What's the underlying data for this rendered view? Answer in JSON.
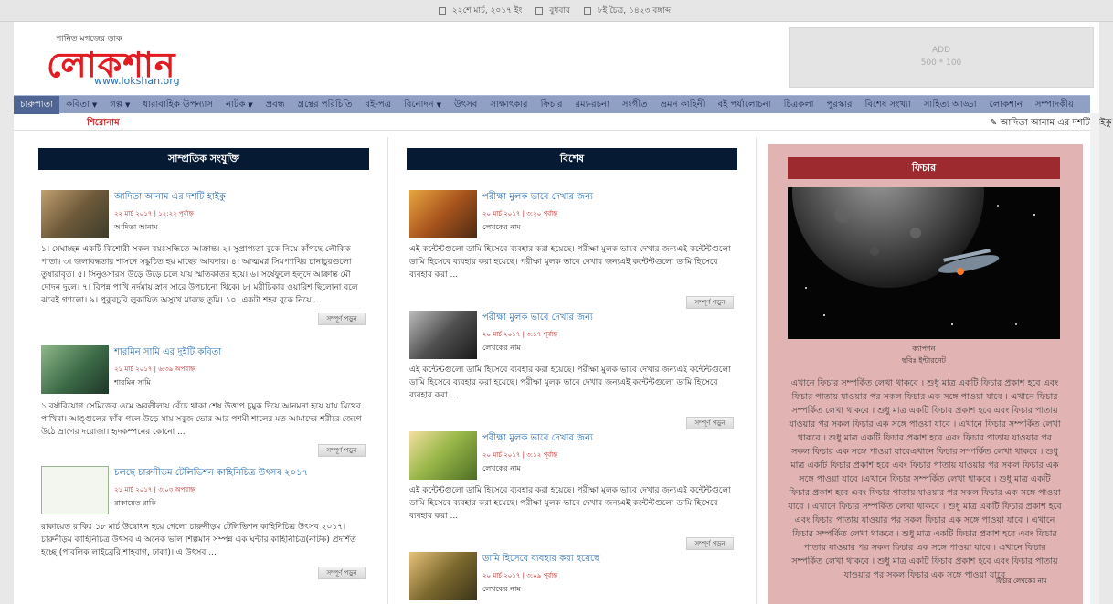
{
  "topbar": {
    "gregorian_date": "২২শে মার্চ, ২০১৭ ইং",
    "weekday": "বুধবার",
    "bengali_date": "৮ই চৈত্র, ১৪২৩ বঙ্গাব্দ"
  },
  "header": {
    "tagline": "শানিত মগজের ডাক",
    "logo": "লোকশান",
    "url": "www.lokshan.org",
    "ad_label": "ADD",
    "ad_size": "500 * 100"
  },
  "nav": {
    "items": [
      {
        "label": "চারুপাতা",
        "dropdown": false
      },
      {
        "label": "কবিতা",
        "dropdown": true
      },
      {
        "label": "গল্প",
        "dropdown": true
      },
      {
        "label": "ধারাবাহিক উপন্যাস",
        "dropdown": false
      },
      {
        "label": "নাটক",
        "dropdown": true
      },
      {
        "label": "প্রবন্ধ",
        "dropdown": false
      },
      {
        "label": "গ্রন্থের পরিচিতি",
        "dropdown": false
      },
      {
        "label": "বই-পত্র",
        "dropdown": false
      },
      {
        "label": "বিনোদন",
        "dropdown": true
      },
      {
        "label": "উৎসব",
        "dropdown": false
      },
      {
        "label": "সাক্ষাৎকার",
        "dropdown": false
      },
      {
        "label": "ফিচার",
        "dropdown": false
      },
      {
        "label": "রম্য-রচনা",
        "dropdown": false
      },
      {
        "label": "সংগীত",
        "dropdown": false
      },
      {
        "label": "ভ্রমন কাহিনী",
        "dropdown": false
      },
      {
        "label": "বই পর্যালোচনা",
        "dropdown": false
      },
      {
        "label": "চিত্রকলা",
        "dropdown": false
      },
      {
        "label": "পুরস্কার",
        "dropdown": false
      },
      {
        "label": "বিশেষ সংখ্যা",
        "dropdown": false
      },
      {
        "label": "সাহিত্য আড্ডা",
        "dropdown": false
      },
      {
        "label": "লোকশান",
        "dropdown": false
      },
      {
        "label": "সম্পাদকীয়",
        "dropdown": false
      }
    ]
  },
  "ticker": {
    "heading": "শিরোনাম",
    "message": "আদিতা আনাম এর দশটি হাইকু"
  },
  "recent": {
    "heading": "সাম্প্রতিক সংযুক্তি",
    "more_label": "সম্পূর্ণ পড়ুন",
    "articles": [
      {
        "title": "আদিতা আনাম এর দশটি হাইকু",
        "date": "২২ মার্চ ২০১৭ | ১২:২২ পূর্বাহ্ন",
        "author": "আদিতা আনাম",
        "excerpt": "১। মেঘাচ্ছন্ন একটি কিশোরী সকল বয়ঃসন্ধিতে আক্রান্ত। ২। সুপ্রাপ্যতা বুকে নিয়ে কাঁপছে লৌকিক পাতা। ৩। জলাবদ্ধতার শাসনে সঙ্কুচিত হয় মাছের আবদার। ৪। আত্মমগ্ন সিমপ্যাথির চানাচুরগুলো তুষারাবৃত। ৫। সিনুওসারস উড়ে উড়ে চলে যায় স্মতিকাতর হয়ে। ৬। সর্ষেফুলে হলুদে আক্রান্ত মৌ দোদন দুলে। ৭। বিপন্ন পাখি নর্দমায় স্নান সারে উপচানো থিকে। ৮। মরীচিকার ওয়ারিশ ছিলোনা বলে ঝরেই গ্যালো। ৯। পুকুরচুরি লুকায়িত অসুখে মারছে তুমি। ১০। একটা শহর বুকে নিয়ে ..."
      },
      {
        "title": "শারমিন সামি এর দুইটি কবিতা",
        "date": "২১ মার্চ ২০১৭ | ৬:৩৯ অপরাহ্ন",
        "author": "শারমিন সামি",
        "excerpt": "১ বর্ষাবিয়োগ সেমিজের ওমে অবলীলায় বেঁচে থাকা শেষ উত্তাপ চুমুক দিয়ে আনমনা হয়ে যায় মিথের পাখিরা। আঙ্গুলের ফাঁক গলে উড়ে যায় সবুজ ভোর আর পশমী শালের মত আমাদের শরীরে জেগে উঠে ভ্রাণের দরোজা। হৃদকম্পনের কোনো ..."
      },
      {
        "title": "চলছে চারুনীড়ম টেলিভিশন কাহিনিচিত্র উৎসব ২০১৭",
        "date": "২১ মার্চ ২০১৭ | ৩:০৩ অপরাহ্ন",
        "author": "রাকায়েত রাকি",
        "excerpt": "রাকায়েত রাকিঃ ১৮ মার্চ উদ্বোধন হয়ে গেলো চারুনীড়ম টেলিভিশন কাহিনিচিত্র উৎসব ২০১৭। চারুনীড়ম কাহিনিচিত্র উৎসব এ অনেক ভাল শিল্পমান সম্পন্ন এক ঘন্টার কাহিনিচিত্র(নাটক) প্রদর্শিত হচ্ছে (পাবলিক লাইব্রেরি,শাহবাগ, ঢাকা)। এ উৎসব ..."
      }
    ]
  },
  "special": {
    "heading": "বিশেষ",
    "more_label": "সম্পূর্ণ পড়ুন",
    "articles": [
      {
        "title": "পরীক্ষা মুলক ভাবে দেখার জন্য",
        "date": "২০ মার্চ ২০১৭ | ৩:২০ পূর্বাহ্ন",
        "author": "লেখকের নাম",
        "excerpt": "এই কন্টেন্টগুলো ডামি হিসেবে ব্যবহার করা হয়েছে। পরীক্ষা মুলক ভাবে দেখার জন্যএই কন্টেন্টগুলো ডামি হিসেবে ব্যবহার করা হয়েছে। পরীক্ষা মুলক ভাবে দেখার জন্যএই কন্টেন্টগুলো ডামি হিসেবে ব্যবহার করা ..."
      },
      {
        "title": "পরীক্ষা মুলক ভাবে দেখার জন্য",
        "date": "২০ মার্চ ২০১৭ | ৩:১৭ পূর্বাহ্ন",
        "author": "লেখকের নাম",
        "excerpt": "এই কন্টেন্টগুলো ডামি হিসেবে ব্যবহার করা হয়েছে। পরীক্ষা মুলক ভাবে দেখার জন্যএই কন্টেন্টগুলো ডামি হিসেবে ব্যবহার করা হয়েছে। পরীক্ষা মুলক ভাবে দেখার জন্যএই কন্টেন্টগুলো ডামি হিসেবে ব্যবহার করা ..."
      },
      {
        "title": "পরীক্ষা মুলক ভাবে দেখার জন্য",
        "date": "২০ মার্চ ২০১৭ | ৩:১২ পূর্বাহ্ন",
        "author": "লেখকের নাম",
        "excerpt": "এই কন্টেন্টগুলো ডামি হিসেবে ব্যবহার করা হয়েছে। পরীক্ষা মুলক ভাবে দেখার জন্যএই কন্টেন্টগুলো ডামি হিসেবে ব্যবহার করা হয়েছে। পরীক্ষা মুলক ভাবে দেখার জন্যএই কন্টেন্টগুলো ডামি হিসেবে ব্যবহার করা ..."
      },
      {
        "title": "ডামি হিসেবে ব্যবহার করা হয়েছে",
        "date": "২০ মার্চ ২০১৭ | ৩:০৯ পূর্বাহ্ন",
        "author": "লেখকের নাম",
        "excerpt": ""
      }
    ]
  },
  "feature": {
    "heading": "ফিচার",
    "caption": "ক্যাপশন",
    "photo_credit": "ছবিঃ ইন্টারনেট",
    "body": "এখানে ফিচার সম্পর্কিত লেখা থাকবে । শুধু মাত্র একটি ফিচার প্রকাশ হবে এবং ফিচার পাতায় যাওয়ার পর সকল ফিচার এক সঙ্গে পাওয়া যাবে । এখানে ফিচার সম্পর্কিত লেখা থাকবে । শুধু মাত্র একটি ফিচার প্রকাশ হবে এবং ফিচার পাতায় যাওয়ার পর সকল ফিচার এক সঙ্গে পাওয়া যাবে । এখানে ফিচার সম্পর্কিত লেখা থাকবে । শুধু মাত্র একটি ফিচার প্রকাশ হবে এবং ফিচার পাতায় যাওয়ার পর সকল ফিচার এক সঙ্গে পাওয়া যাবেএখানে ফিচার সম্পর্কিত লেখা থাকবে । শুধু মাত্র একটি ফিচার প্রকাশ হবে এবং ফিচার পাতায় যাওয়ার পর সকল ফিচার এক সঙ্গে পাওয়া যাবে ।এখানে ফিচার সম্পর্কিত লেখা থাকবে । শুধু মাত্র একটি ফিচার প্রকাশ হবে এবং ফিচার পাতায় যাওয়ার পর সকল ফিচার এক সঙ্গে পাওয়া যাবে । এখানে ফিচার সম্পর্কিত লেখা থাকবে । শুধু মাত্র একটি ফিচার প্রকাশ হবে এবং ফিচার পাতায় যাওয়ার পর সকল ফিচার এক সঙ্গে পাওয়া যাবে । এখানে ফিচার সম্পর্কিত লেখা থাকবে । শুধু মাত্র একটি ফিচার প্রকাশ হবে এবং ফিচার পাতায় যাওয়ার পর সকল ফিচার এক সঙ্গে পাওয়া যাবে । এখানে ফিচার সম্পর্কিত লেখা থাকবে । শুধু মাত্র একটি ফিচার প্রকাশ হবে এবং ফিচার পাতায় যাওয়ার পর সকল ফিচার এক সঙ্গে পাওয়া যাবে",
    "author_label": "ফিচার লেখকের নাম"
  }
}
